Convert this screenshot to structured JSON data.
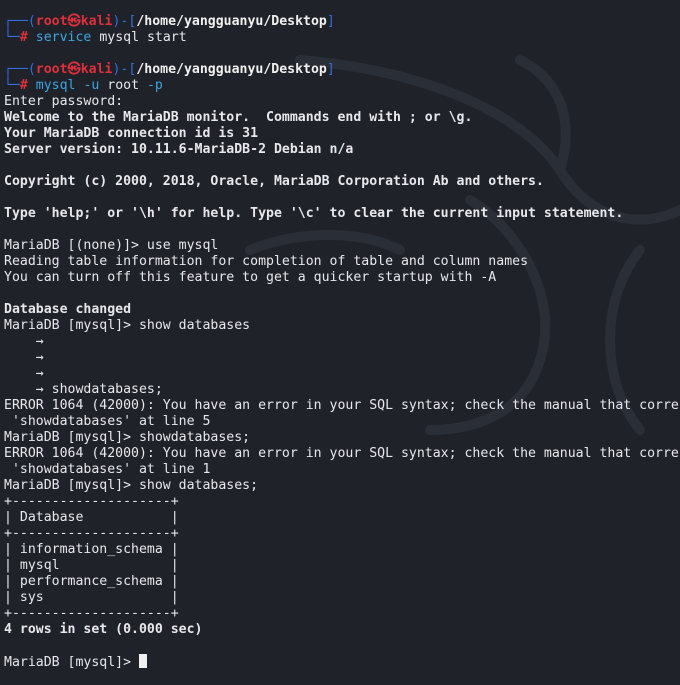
{
  "prompts": [
    {
      "user": "root",
      "at_symbol": "㉿",
      "host": "kali",
      "path": "/home/yangguanyu/Desktop",
      "command": "service",
      "args": " mysql start"
    },
    {
      "user": "root",
      "at_symbol": "㉿",
      "host": "kali",
      "path": "/home/yangguanyu/Desktop",
      "command": "mysql",
      "flag1": " -u",
      "arg1": " root",
      "flag2": " -p"
    }
  ],
  "output": {
    "enter_password": "Enter password:",
    "welcome": "Welcome to the MariaDB monitor.  Commands end with ; or \\g.",
    "connection_id": "Your MariaDB connection id is 31",
    "server_version": "Server version: 10.11.6-MariaDB-2 Debian n/a",
    "copyright": "Copyright (c) 2000, 2018, Oracle, MariaDB Corporation Ab and others.",
    "help_hint": "Type 'help;' or '\\h' for help. Type '\\c' to clear the current input statement.",
    "use_mysql": "MariaDB [(none)]> use mysql",
    "reading_info": "Reading table information for completion of table and column names",
    "turn_off": "You can turn off this feature to get a quicker startup with -A",
    "db_changed": "Database changed",
    "show_databases_1": "MariaDB [mysql]> show databases",
    "cont_1": "    →",
    "cont_2": "    →",
    "cont_3": "    →",
    "cont_4": "    → showdatabases;",
    "error_1a": "ERROR 1064 (42000): You have an error in your SQL syntax; check the manual that corre",
    "error_1b": " 'showdatabases' at line 5",
    "showdatabases_2": "MariaDB [mysql]> showdatabases;",
    "error_2a": "ERROR 1064 (42000): You have an error in your SQL syntax; check the manual that corre",
    "error_2b": " 'showdatabases' at line 1",
    "show_databases_3": "MariaDB [mysql]> show databases;",
    "table_border": "+--------------------+",
    "table_header": "| Database           |",
    "table_rows": [
      "| information_schema |",
      "| mysql              |",
      "| performance_schema |",
      "| sys                |"
    ],
    "rows_in_set": "4 rows in set (0.000 sec)",
    "final_prompt": "MariaDB [mysql]> "
  },
  "colors": {
    "background": "#1f2229",
    "prompt_frame": "#2f6fde",
    "prompt_user": "#e0303a",
    "command": "#3aa6e2"
  }
}
